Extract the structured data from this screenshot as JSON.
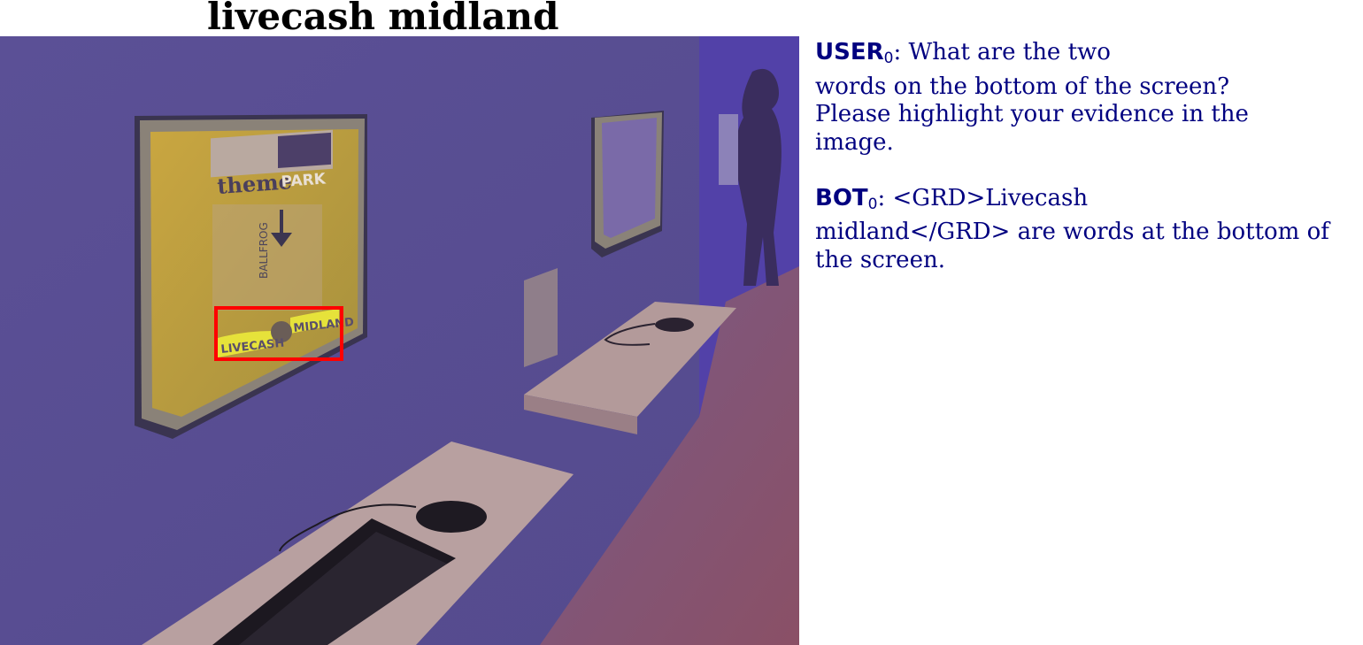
{
  "title": "livecash midland",
  "photo": {
    "screen_logo_left": "theme",
    "screen_logo_right": "PARK",
    "screen_caption": "BALLFROG",
    "bottom_word_left": "LIVECASH",
    "bottom_word_right": "MIDLAND",
    "highlight_color": "#ff0000",
    "tint_color": "#5a4f9e"
  },
  "chat": {
    "user": {
      "speaker": "USER",
      "index": "0",
      "lines": [
        ": What are the two",
        "words on the bottom of the screen?",
        "Please highlight your evidence in the",
        "image."
      ]
    },
    "bot": {
      "speaker": "BOT",
      "index": "0",
      "lines": [
        ": <GRD>Livecash",
        "midland</GRD> are words at the bottom of",
        "the screen."
      ]
    }
  }
}
